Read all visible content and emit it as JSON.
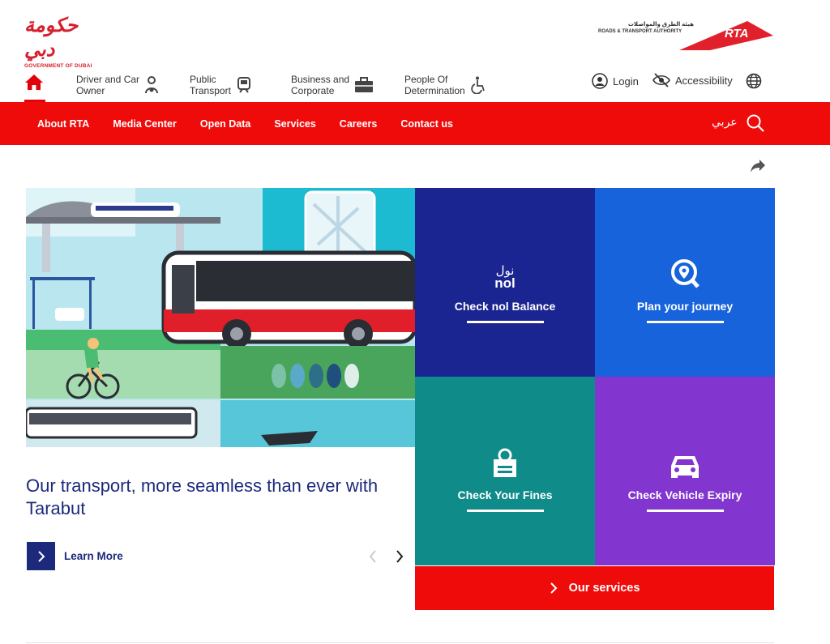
{
  "header": {
    "gov_logo_ar": "حكومة دبي",
    "gov_logo_en": "GOVERNMENT OF DUBAI",
    "rta_logo_ar": "هيئة الطرق والمواصلات",
    "rta_logo_en": "ROADS & TRANSPORT AUTHORITY",
    "rta_logo_mark": "RTA"
  },
  "nav": {
    "items": [
      {
        "label_line1": "Driver and Car",
        "label_line2": "Owner",
        "icon": "driver-icon"
      },
      {
        "label_line1": "Public",
        "label_line2": "Transport",
        "icon": "metro-icon"
      },
      {
        "label_line1": "Business and",
        "label_line2": "Corporate",
        "icon": "briefcase-icon"
      },
      {
        "label_line1": "People Of",
        "label_line2": "Determination",
        "icon": "wheelchair-icon"
      }
    ],
    "login": "Login",
    "accessibility": "Accessibility"
  },
  "menu": {
    "items": [
      "About RTA",
      "Media Center",
      "Open Data",
      "Services",
      "Careers",
      "Contact us"
    ],
    "arabic": "عربي"
  },
  "hero": {
    "title": "Our transport, more seamless than ever with Tarabut",
    "learn_more": "Learn More"
  },
  "tiles": [
    {
      "label": "Check nol Balance",
      "icon": "nol-icon",
      "icon_ar": "نول",
      "icon_en": "nol",
      "color": "#1b2591"
    },
    {
      "label": "Plan your journey",
      "icon": "location-pin-icon",
      "color": "#1763db"
    },
    {
      "label": "Check Your Fines",
      "icon": "fines-icon",
      "color": "#0f8b8a"
    },
    {
      "label": "Check Vehicle Expiry",
      "icon": "car-icon",
      "color": "#8235cf"
    }
  ],
  "our_services": "Our services",
  "colors": {
    "accent_red": "#f00b0b",
    "navy": "#1d2a7c"
  }
}
